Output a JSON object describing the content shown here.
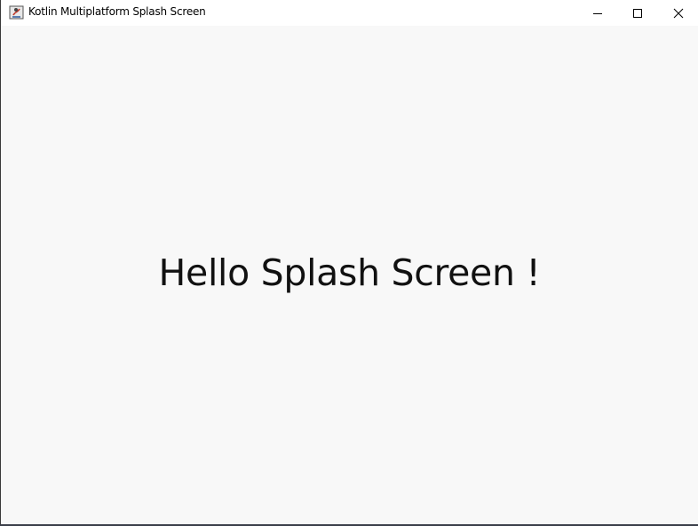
{
  "window": {
    "title": "Kotlin Multiplatform Splash Screen",
    "app_icon": "java-app-icon",
    "controls": {
      "minimize": "minimize-icon",
      "maximize": "maximize-icon",
      "close": "close-icon"
    }
  },
  "content": {
    "message": "Hello Splash Screen !"
  },
  "colors": {
    "titlebar": "#ffffff",
    "background": "#f8f8f8",
    "text": "#111111"
  }
}
